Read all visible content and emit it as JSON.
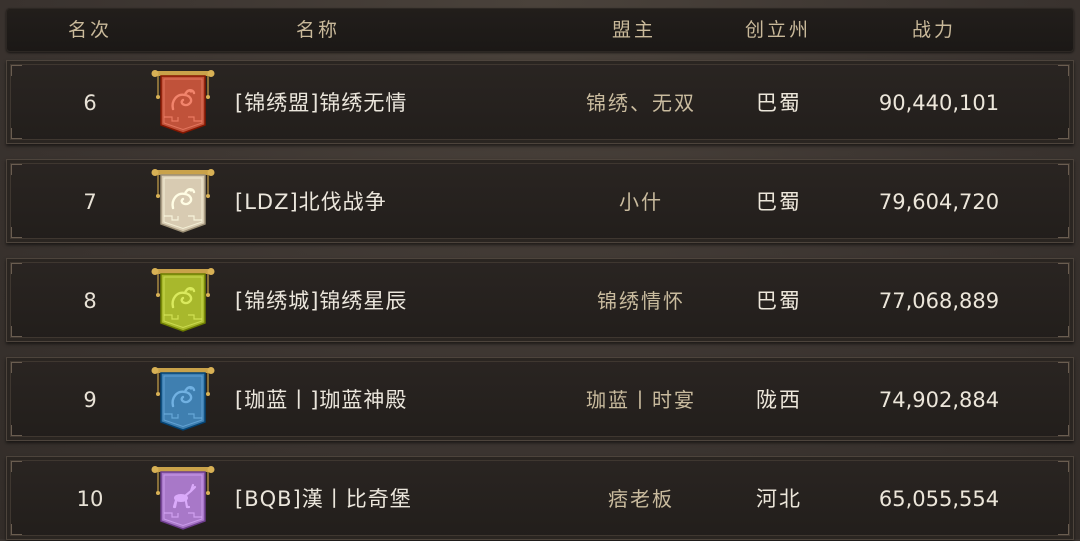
{
  "header": {
    "rank": "名次",
    "name": "名称",
    "leader": "盟主",
    "state": "创立州",
    "power": "战力"
  },
  "rows": [
    {
      "rank": "6",
      "name": "[锦绣盟]锦绣无情",
      "leader": "锦绣、无双",
      "state": "巴蜀",
      "power": "90,440,101",
      "banner_icon": "dragon-banner-icon",
      "banner_color": "#c0523a"
    },
    {
      "rank": "7",
      "name": "[LDZ]北伐战争",
      "leader": "小什",
      "state": "巴蜀",
      "power": "79,604,720",
      "banner_icon": "dragon-banner-icon",
      "banner_color": "#d8cbb2"
    },
    {
      "rank": "8",
      "name": "[锦绣城]锦绣星辰",
      "leader": "锦绣情怀",
      "state": "巴蜀",
      "power": "77,068,889",
      "banner_icon": "dragon-banner-icon",
      "banner_color": "#a8b82c"
    },
    {
      "rank": "9",
      "name": "[珈蓝丨]珈蓝神殿",
      "leader": "珈蓝丨时宴",
      "state": "陇西",
      "power": "74,902,884",
      "banner_icon": "dragon-banner-icon",
      "banner_color": "#3f7fb0"
    },
    {
      "rank": "10",
      "name": "[BQB]漢丨比奇堡",
      "leader": "痞老板",
      "state": "河北",
      "power": "65,055,554",
      "banner_icon": "deer-banner-icon",
      "banner_color": "#a878c8"
    }
  ]
}
